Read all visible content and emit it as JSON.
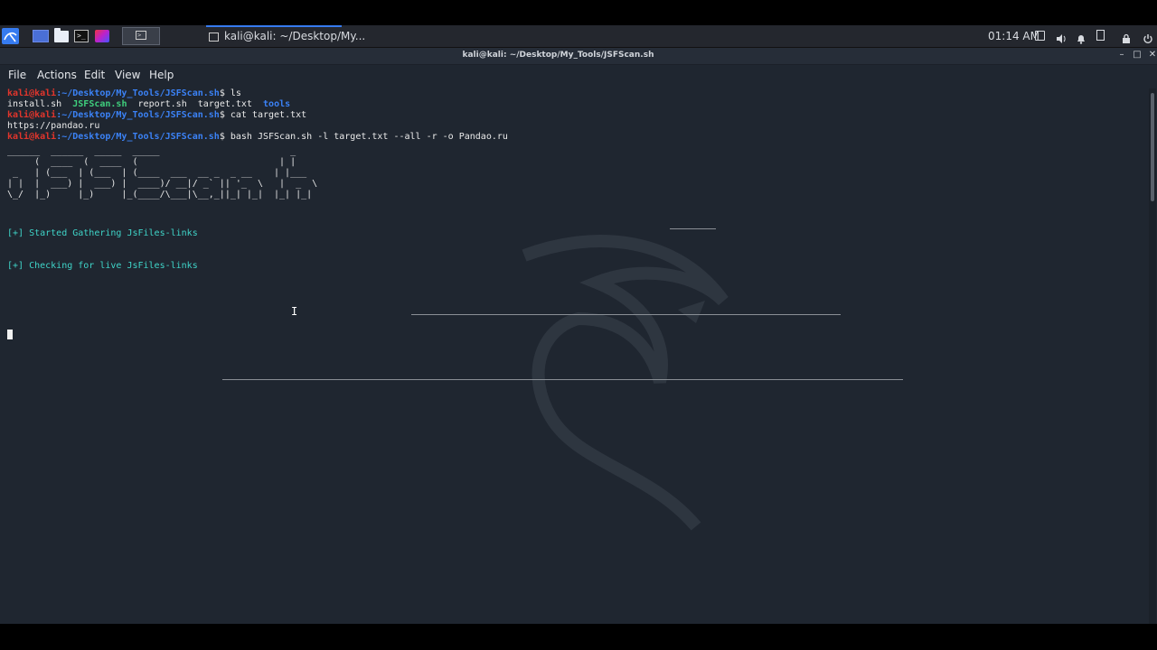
{
  "taskbar": {
    "window_task_label": "kali@kali: ~/Desktop/My...",
    "clock": "01:14 AM"
  },
  "window": {
    "title": "kali@kali: ~/Desktop/My_Tools/JSFScan.sh",
    "menu": [
      "File",
      "Actions",
      "Edit",
      "View",
      "Help"
    ]
  },
  "terminal": {
    "prompt_user": "kali@kali",
    "prompt_path": ":~/Desktop/My_Tools/JSFScan.sh",
    "prompt_symbol": "$ ",
    "cmd1": "ls",
    "ls_output": {
      "file1": "install.sh",
      "file2": "JSFScan.sh",
      "file3": "report.sh",
      "file4": "target.txt",
      "file5": "tools"
    },
    "cmd2": "cat target.txt",
    "cat_output": "https://pandao.ru",
    "cmd3": "bash JSFScan.sh -l target.txt --all -r -o Pandao.ru",
    "banner": {
      "line1": "______  ______  _____  _____                        _",
      "line2": "     (  ____  (  ____  (                          | |",
      "line3": " _   | (___  | (___  | (____  ___  __ _  _ __    | |___",
      "line4": "| |  |  ___) |  ___) |  ____)/ __|/ _` || '_  \\   |  _  \\",
      "line5": "\\_/  |_)     |_)     |_(____/\\___|\\__,_||_| |_|  |_| |_|"
    },
    "msg1": "[+] Started Gathering JsFiles-links",
    "msg2": "[+] Checking for live JsFiles-links"
  }
}
